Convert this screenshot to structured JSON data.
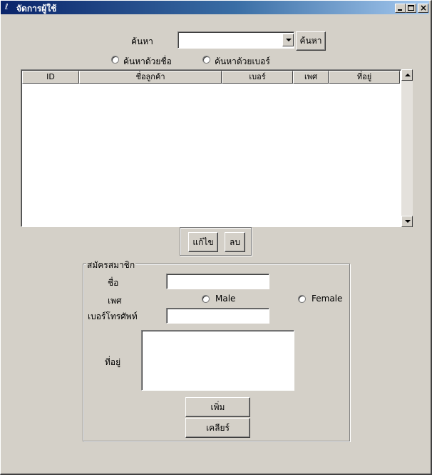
{
  "window": {
    "title": "จัดการผู้ใช้"
  },
  "search": {
    "label": "ค้นหา",
    "combo_value": "",
    "button": "ค้นหา",
    "radio_name": "ค้นหาด้วยชื่อ",
    "radio_phone": "ค้นหาด้วยเบอร์"
  },
  "table": {
    "columns": [
      "ID",
      "ชื่อลูกค้า",
      "เบอร์",
      "เพศ",
      "ที่อยู่"
    ],
    "rows": []
  },
  "actions": {
    "edit": "แก้ไข",
    "delete": "ลบ"
  },
  "register": {
    "group_title": "สมัครสมาชิก",
    "name_label": "ชื่อ",
    "name_value": "",
    "gender_label": "เพศ",
    "male": "Male",
    "female": "Female",
    "phone_label": "เบอร์โทรศัพท์",
    "phone_value": "",
    "address_label": "ที่อยู่",
    "address_value": "",
    "add_button": "เพิ่ม",
    "clear_button": "เคลียร์"
  }
}
